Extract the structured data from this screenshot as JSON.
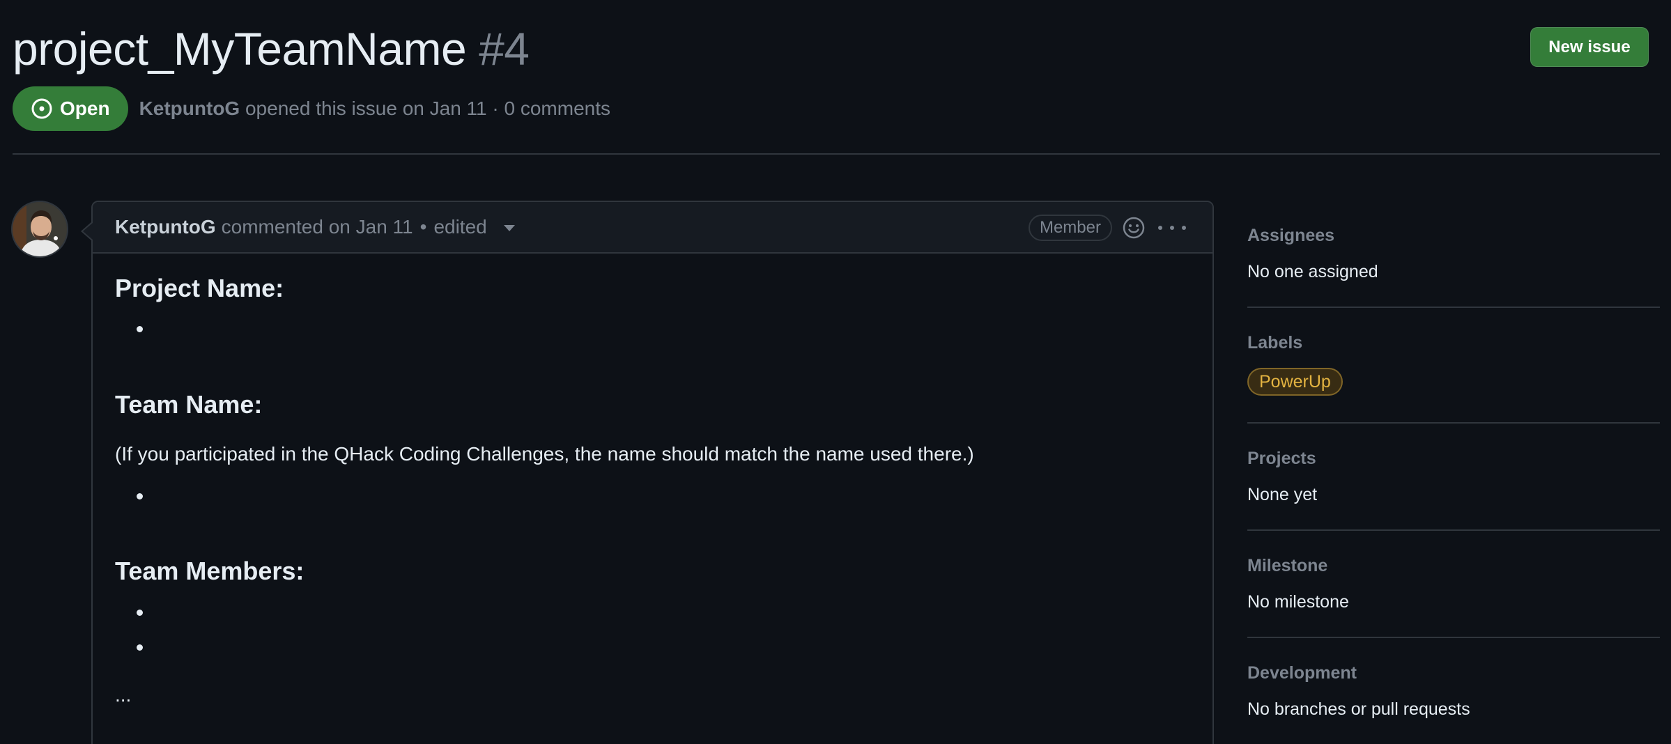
{
  "issue": {
    "title": "project_MyTeamName",
    "number": "#4",
    "state": "Open",
    "author": "KetpuntoG",
    "meta_text": "opened this issue on Jan 11 · 0 comments",
    "new_issue_label": "New issue"
  },
  "comment": {
    "author": "KetpuntoG",
    "action": "commented on Jan 11",
    "separator": "•",
    "edited": "edited",
    "role_badge": "Member",
    "body": {
      "heading_project": "Project Name:",
      "heading_team": "Team Name:",
      "team_note": "(If you participated in the QHack Coding Challenges, the name should match the name used there.)",
      "heading_members": "Team Members:",
      "ellipsis": "..."
    }
  },
  "sidebar": {
    "assignees": {
      "heading": "Assignees",
      "value": "No one assigned"
    },
    "labels": {
      "heading": "Labels",
      "items": [
        "PowerUp"
      ]
    },
    "projects": {
      "heading": "Projects",
      "value": "None yet"
    },
    "milestone": {
      "heading": "Milestone",
      "value": "No milestone"
    },
    "development": {
      "heading": "Development",
      "value": "No branches or pull requests"
    }
  },
  "colors": {
    "background": "#0d1117",
    "open_green": "#347d39",
    "label_yellow": "#e3b341",
    "muted_text": "#7d8590",
    "border": "#30363d"
  },
  "icons": {
    "state": "issue-opened-icon",
    "reaction": "smiley-icon",
    "more": "kebab-horizontal-icon",
    "caret": "triangle-down-icon"
  }
}
